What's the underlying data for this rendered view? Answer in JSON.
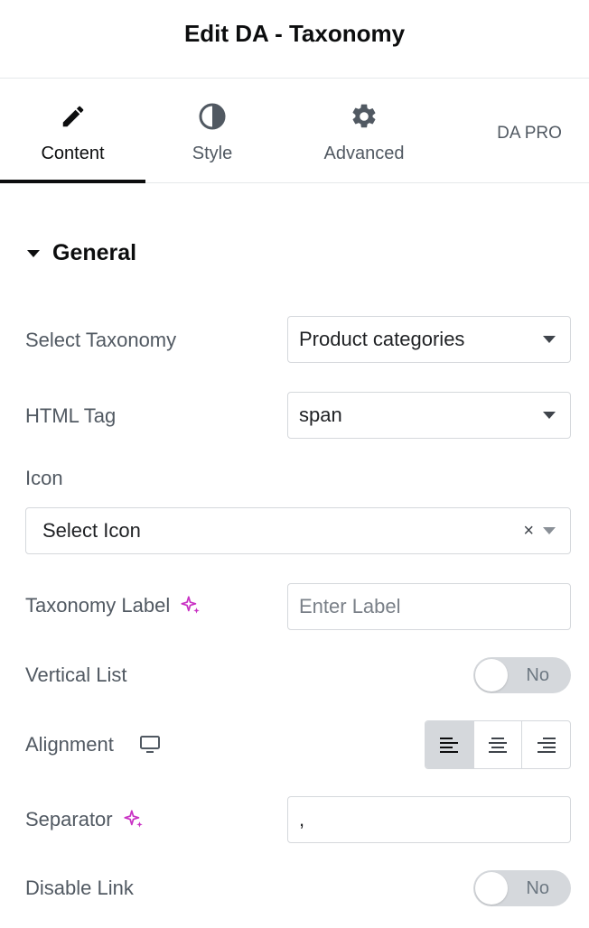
{
  "panel": {
    "title": "Edit DA - Taxonomy"
  },
  "tabs": [
    {
      "label": "Content",
      "icon": "pencil-icon",
      "active": true
    },
    {
      "label": "Style",
      "icon": "half-circle-icon",
      "active": false
    },
    {
      "label": "Advanced",
      "icon": "gear-icon",
      "active": false
    },
    {
      "label": "DA PRO",
      "icon": "",
      "active": false
    }
  ],
  "section": {
    "title": "General",
    "expanded": true
  },
  "fields": {
    "select_taxonomy": {
      "label": "Select Taxonomy",
      "value": "Product categories"
    },
    "html_tag": {
      "label": "HTML Tag",
      "value": "span"
    },
    "icon": {
      "label": "Icon",
      "placeholder": "Select Icon"
    },
    "taxonomy_label": {
      "label": "Taxonomy Label",
      "placeholder": "Enter Label"
    },
    "vertical_list": {
      "label": "Vertical List",
      "state": "No"
    },
    "alignment": {
      "label": "Alignment",
      "selected": "left"
    },
    "separator": {
      "label": "Separator",
      "value": ","
    },
    "disable_link": {
      "label": "Disable Link",
      "state": "No"
    }
  },
  "colors": {
    "ai_accent": "#c932c4",
    "active_underline": "#0c0d0e",
    "toggle_off": "#d5d8dc"
  }
}
